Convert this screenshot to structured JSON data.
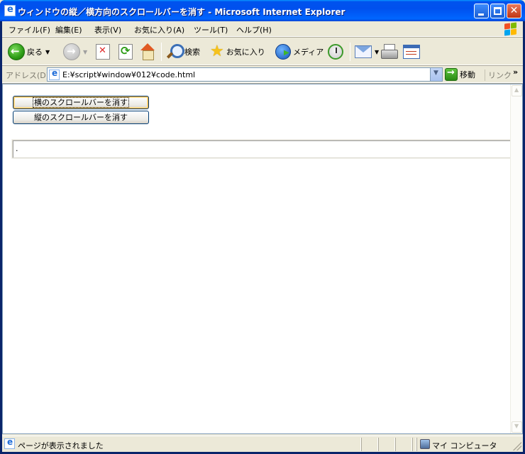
{
  "window": {
    "title": "ウィンドウの縦／横方向のスクロールバーを消す - Microsoft Internet Explorer"
  },
  "menu": {
    "items": [
      "ファイル(F)",
      "編集(E)",
      "表示(V)",
      "お気に入り(A)",
      "ツール(T)",
      "ヘルプ(H)"
    ]
  },
  "toolbar": {
    "back_label": "戻る",
    "search_label": "検索",
    "favorites_label": "お気に入り",
    "media_label": "メディア"
  },
  "address": {
    "label": "アドレス(D)",
    "value": "E:¥script¥window¥012¥code.html",
    "go_label": "移動",
    "links_label": "リンク",
    "more": "»"
  },
  "page": {
    "buttons": [
      "横のスクロールバーを消す",
      "縦のスクロールバーを消す"
    ],
    "output": "."
  },
  "status": {
    "text": "ページが表示されました",
    "zone": "マイ コンピュータ"
  },
  "icons": [
    "ie-icon",
    "minimize-icon",
    "maximize-icon",
    "close-icon",
    "windows-logo-icon",
    "back-icon",
    "forward-icon",
    "stop-icon",
    "refresh-icon",
    "home-icon",
    "search-icon",
    "star-icon",
    "media-icon",
    "history-icon",
    "mail-icon",
    "print-icon",
    "edit-icon",
    "go-icon",
    "computer-icon"
  ],
  "colors": {
    "titlebar": "#0053ee",
    "chrome": "#ece9d8",
    "focus_ring": "#f8b33f"
  }
}
